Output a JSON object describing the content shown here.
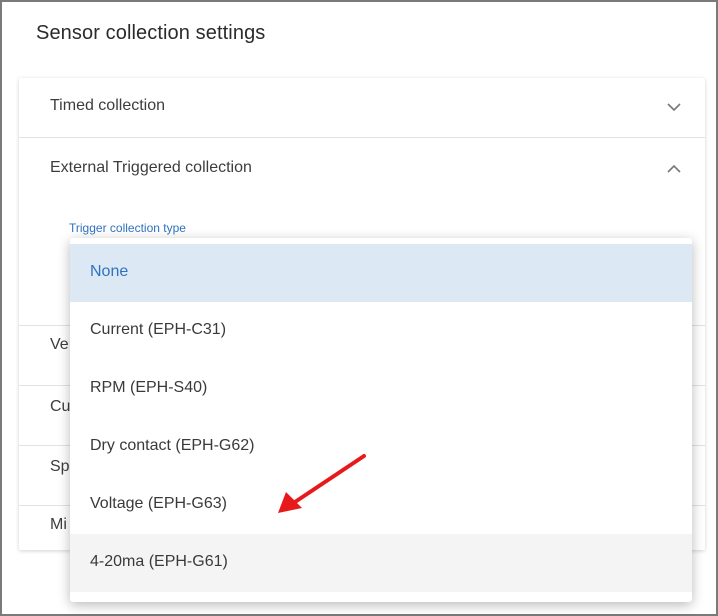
{
  "title": "Sensor collection settings",
  "sections": {
    "timed": "Timed collection",
    "external": "External Triggered collection",
    "trigger_label": "Trigger collection type",
    "stubs": [
      "Ve",
      "Cu",
      "Sp",
      "Mi"
    ]
  },
  "dropdown": {
    "options": [
      "None",
      "Current (EPH-C31)",
      "RPM (EPH-S40)",
      "Dry contact (EPH-G62)",
      "Voltage (EPH-G63)",
      "4-20ma (EPH-G61)"
    ],
    "selected_index": 0,
    "hover_index": 5
  },
  "colors": {
    "accent": "#2f73c0",
    "selected_bg": "#dce8f4",
    "annotation_arrow": "#e8191b"
  },
  "icons": {
    "timed_chevron": "chevron-down-icon",
    "external_chevron": "chevron-up-icon"
  }
}
